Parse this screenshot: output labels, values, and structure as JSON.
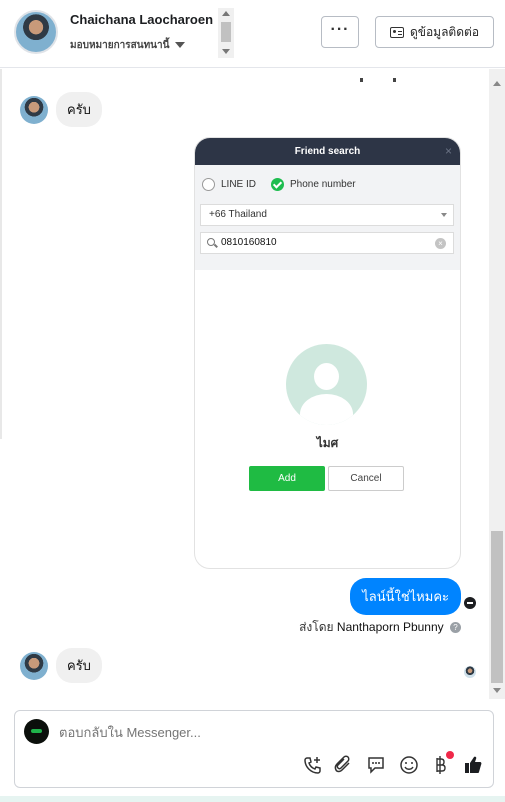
{
  "header": {
    "name": "Chaichana Laocharoen",
    "subtitle": "มอบหมายการสนทนานี้",
    "more_label": "···",
    "contact_label": "ดูข้อมูลติดต่อ"
  },
  "messages": {
    "incoming_1": "ครับ",
    "outgoing_1": "ไลน์นี้ใช่ไหมคะ",
    "sent_by_prefix": "ส่งโดย",
    "sent_by_name": "Nanthaporn Pbunny",
    "incoming_2": "ครับ"
  },
  "friend_search": {
    "title": "Friend search",
    "close": "×",
    "option_line_id": "LINE ID",
    "option_phone": "Phone number",
    "country": "+66  Thailand",
    "phone_value": "0810160810",
    "result_name": "ไมศ",
    "add_label": "Add",
    "cancel_label": "Cancel"
  },
  "composer": {
    "placeholder": "ตอบกลับใน Messenger..."
  },
  "colors": {
    "accent_blue": "#0084ff",
    "line_green": "#1fbb43",
    "dialog_header": "#2d3546"
  },
  "icons": {
    "tools": [
      "call-add-icon",
      "attachment-icon",
      "saved-reply-icon",
      "emoji-icon",
      "payment-icon",
      "like-icon"
    ]
  }
}
